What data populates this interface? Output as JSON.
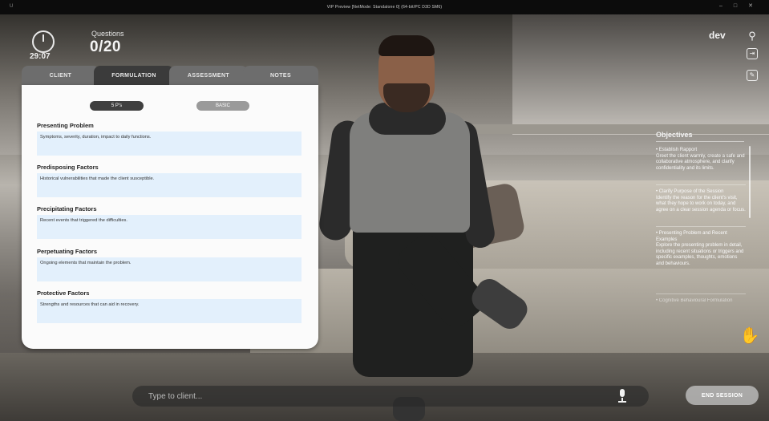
{
  "window": {
    "title": "VIP Preview [NetMode: Standalone 0] (64-bit/PC D3D SM6)",
    "icon": "app-icon",
    "controls": [
      "–",
      "□",
      "✕"
    ]
  },
  "hud": {
    "timer": "29:07",
    "questions_label": "Questions",
    "questions_count": "0/20",
    "user": "dev",
    "tools": [
      "tree-icon",
      "exit-icon",
      "pencil-icon"
    ]
  },
  "panel": {
    "tabs": [
      {
        "label": "CLIENT",
        "active": false
      },
      {
        "label": "FORMULATION",
        "active": true
      },
      {
        "label": "ASSESSMENT",
        "active": false
      },
      {
        "label": "NOTES",
        "active": false
      }
    ],
    "pills": [
      {
        "label": "5 P's",
        "color": "#3f3f3f"
      },
      {
        "label": "BASIC",
        "color": "#9a9a9a"
      }
    ],
    "sections": [
      {
        "title": "Presenting Problem",
        "placeholder": "Symptoms, severity, duration, impact to daily functions."
      },
      {
        "title": "Predisposing Factors",
        "placeholder": "Historical vulnerabilities that made the client susceptible."
      },
      {
        "title": "Precipitating Factors",
        "placeholder": "Recent events that triggered the difficulties."
      },
      {
        "title": "Perpetuating Factors",
        "placeholder": "Ongoing elements that maintain the problem."
      },
      {
        "title": "Protective Factors",
        "placeholder": "Strengths and resources that can aid in recovery."
      }
    ]
  },
  "objectives": {
    "title": "Objectives",
    "items": [
      "• Establish Rapport\nGreet the client warmly, create a safe and collaborative atmosphere, and clarify confidentiality and its limits.",
      "• Clarify Purpose of the Session\nIdentify the reason for the client's visit, what they hope to work on today, and agree on a clear session agenda or focus.",
      "• Presenting Problem and Recent Examples\nExplore the presenting problem in detail, including recent situations or triggers and specific examples, thoughts, emotions and behaviours.",
      "• Cognitive Behavioural Formulation"
    ]
  },
  "chat": {
    "placeholder": "Type to client...",
    "mic": "microphone-icon"
  },
  "end_session_label": "END SESSION",
  "raise_hand": "raise-hand-icon"
}
